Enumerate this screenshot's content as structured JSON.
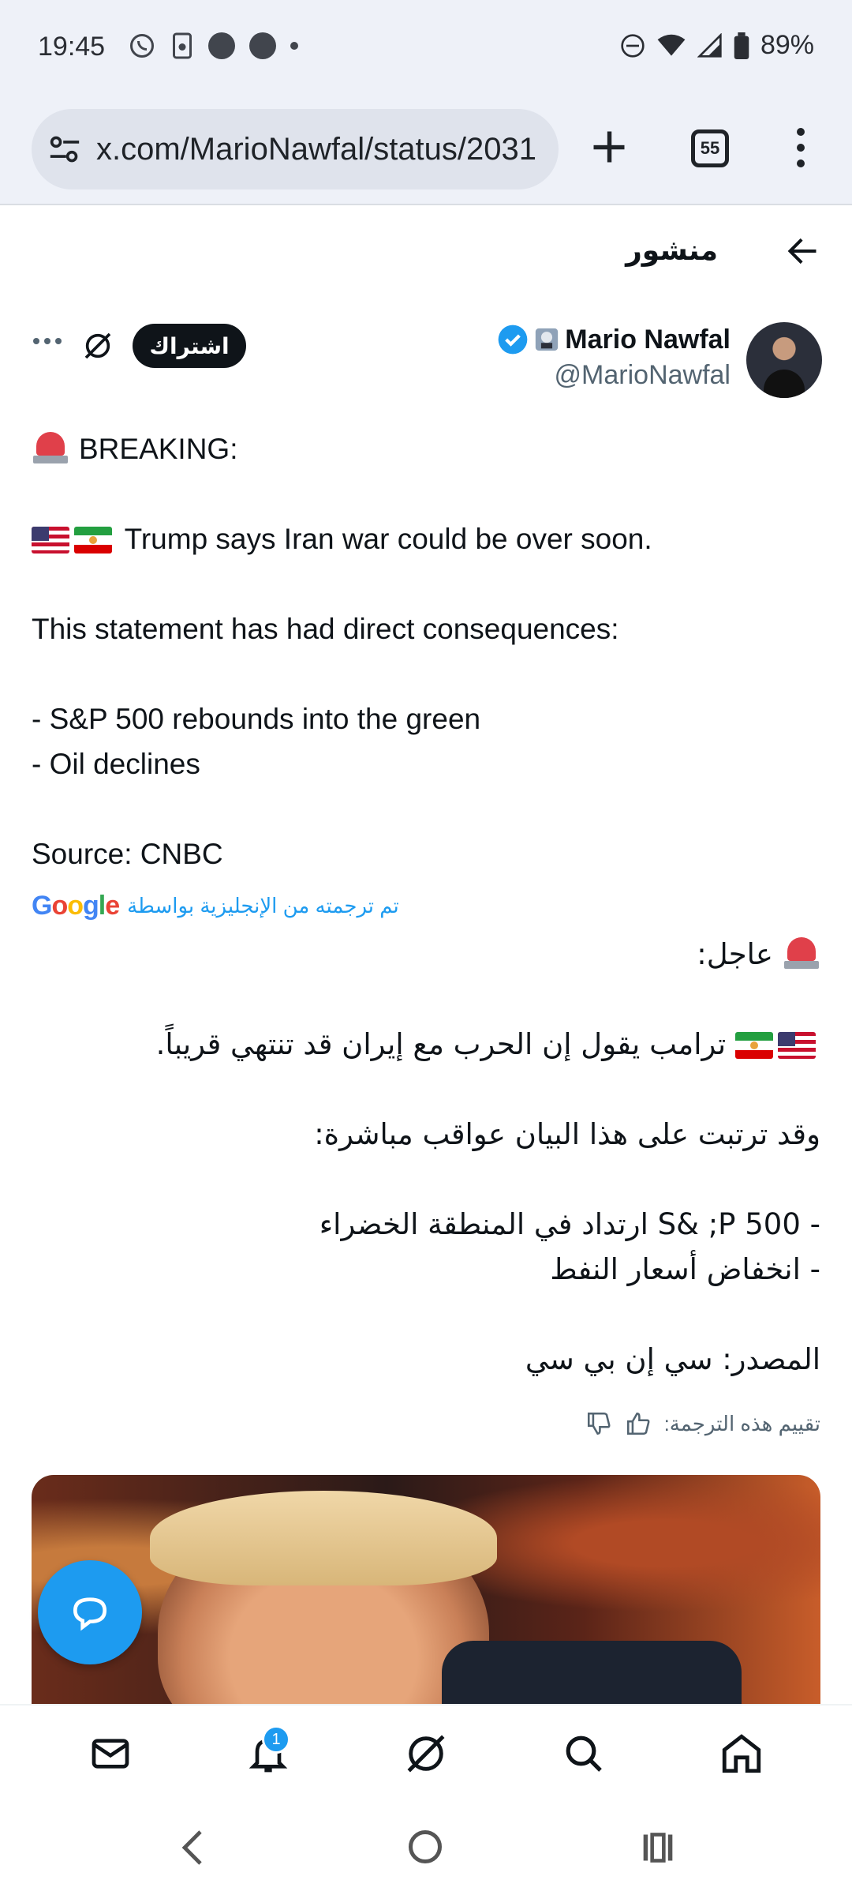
{
  "status_bar": {
    "time": "19:45",
    "battery": "89%"
  },
  "browser": {
    "url": "x.com/MarioNawfal/status/2031",
    "tab_count": "55"
  },
  "header": {
    "title": "منشور"
  },
  "author": {
    "name": "Mario Nawfal",
    "handle": "@MarioNawfal",
    "subscribe_label": "اشتراك"
  },
  "tweet": {
    "line1": "BREAKING:",
    "line2": "Trump says Iran war could be over soon.",
    "line3": "This statement has had direct consequences:",
    "line4": "- S&P 500 rebounds into the green",
    "line5": "- Oil declines",
    "line6": "Source: CNBC"
  },
  "translation": {
    "by_label": "تم ترجمته من الإنجليزية بواسطة",
    "provider": "Google",
    "line1": "عاجل:",
    "line2": "ترامب يقول إن الحرب مع إيران قد تنتهي قريباً.",
    "line3": "وقد ترتبت على هذا البيان عواقب مباشرة:",
    "line4": "- S& ;P 500 ارتداد في المنطقة الخضراء",
    "line5": "- انخفاض أسعار النفط",
    "line6": "المصدر: سي إن بي سي",
    "rate_label": "تقييم هذه الترجمة:"
  },
  "bottom_nav": {
    "items": [
      "messages-icon",
      "notifications-icon",
      "grok-icon",
      "search-icon",
      "home-icon"
    ],
    "notification_count": "1"
  },
  "colors": {
    "accent": "#1d9bf0",
    "text": "#0f1419",
    "muted": "#536471"
  }
}
